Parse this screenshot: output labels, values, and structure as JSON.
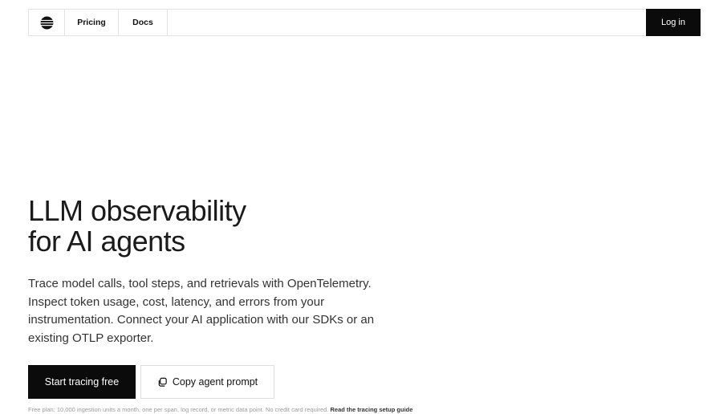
{
  "nav": {
    "logo_icon": "globe-logo-icon",
    "pricing": "Pricing",
    "docs": "Docs",
    "login": "Log in"
  },
  "hero": {
    "title_line1": "LLM observability",
    "title_line2": "for AI agents",
    "description": "Trace model calls, tool steps, and retrievals with OpenTelemetry. Inspect token usage, cost, latency, and errors from your instrumentation. Connect your AI application with our SDKs or an existing OTLP exporter.",
    "primary_cta": "Start tracing free",
    "secondary_cta": "Copy agent prompt",
    "secondary_icon": "copy-icon"
  },
  "footnote": {
    "text": "Free plan: 10,000 ingestion units a month, one per span, log record, or metric data point. No credit card required.",
    "link": "Read the tracing setup guide"
  },
  "colors": {
    "primary": "#0b0b0b",
    "background": "#ffffff",
    "border": "#e2e2e2"
  }
}
